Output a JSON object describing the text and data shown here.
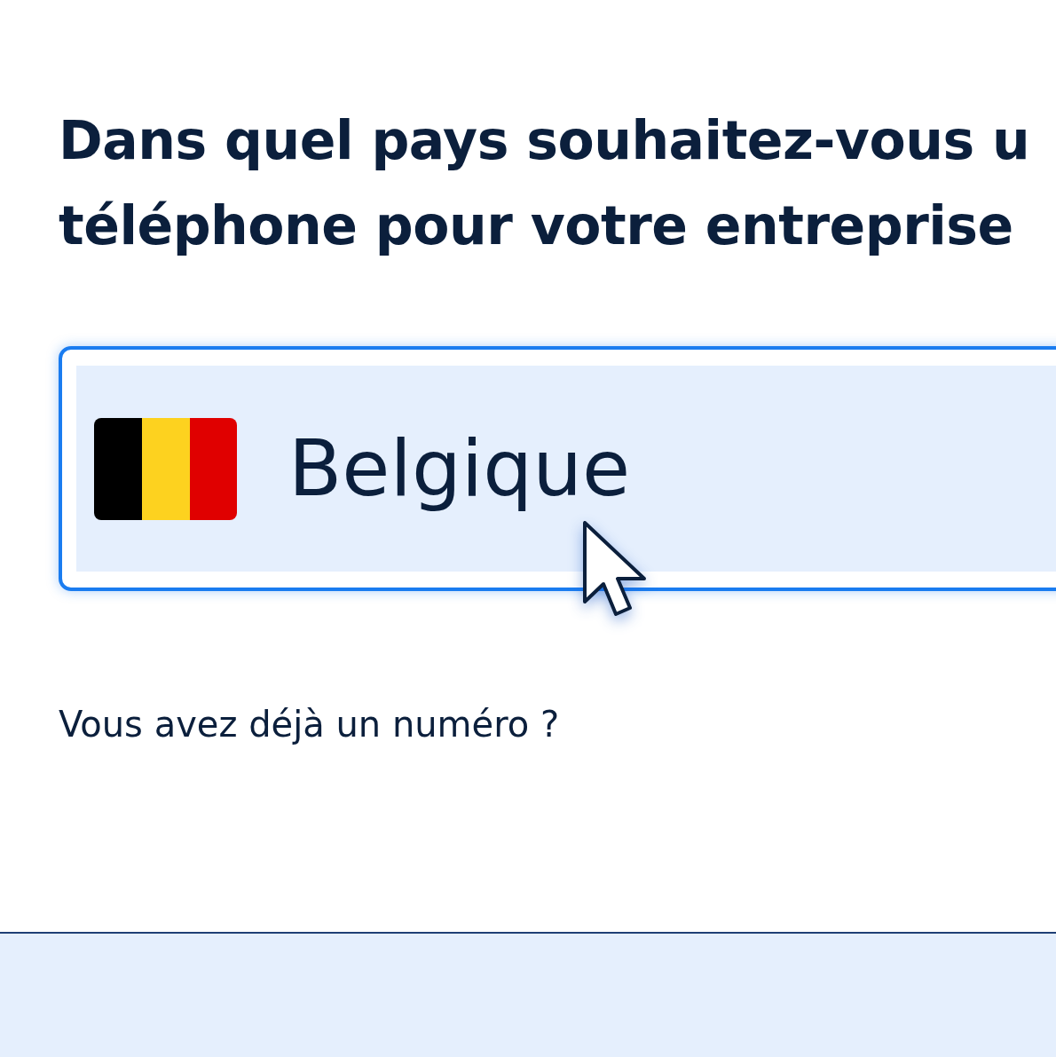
{
  "question": [
    "Dans quel pays souhaitez-vous u",
    "téléphone pour votre entreprise"
  ],
  "country_select": {
    "value": "Belgique",
    "focused": true
  },
  "link": "Vous avez déjà un numéro ?"
}
